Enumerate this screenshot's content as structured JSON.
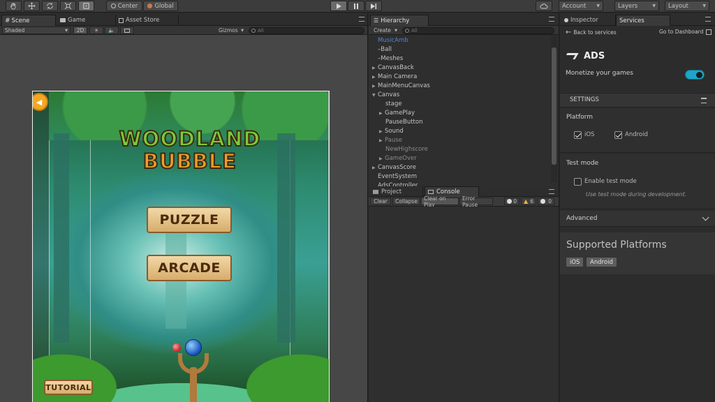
{
  "toolbar": {
    "pivot": "Center",
    "space": "Global",
    "account": "Account",
    "layers": "Layers",
    "layout": "Layout"
  },
  "scene": {
    "tabs": [
      "Scene",
      "Game",
      "Asset Store"
    ],
    "shading": "Shaded",
    "mode2d": "2D",
    "gizmos": "Gizmos",
    "search_placeholder": "All"
  },
  "game": {
    "title_line1": "WOODLAND",
    "title_line2": "BUBBLE",
    "puzzle": "PUZZLE",
    "arcade": "ARCADE",
    "tutorial": "TUTORIAL"
  },
  "hierarchy": {
    "tab": "Hierarchy",
    "create": "Create",
    "search_placeholder": "All",
    "items": [
      "MusicAmb",
      "Ball",
      "Meshes",
      "CanvasBack",
      "Main Camera",
      "MainMenuCanvas",
      "Canvas",
      "stage",
      "GamePlay",
      "PauseButton",
      "Sound",
      "Pause",
      "NewHighscore",
      "GameOver",
      "CanvasScore",
      "EventSystem",
      "AdsController"
    ]
  },
  "console": {
    "tabs": [
      "Project",
      "Console"
    ],
    "buttons": [
      "Clear",
      "Collapse",
      "Clear on Play",
      "Error Pause"
    ],
    "counts": [
      "0",
      "6",
      "0"
    ]
  },
  "inspector": {
    "tabs": [
      "Inspector",
      "Services"
    ],
    "back": "Back to services",
    "dashboard": "Go to Dashboard",
    "service_name": "ADS",
    "monetize": "Monetize your games",
    "settings": "SETTINGS",
    "platform": "Platform",
    "ios": "iOS",
    "android": "Android",
    "test_mode": "Test mode",
    "enable_test": "Enable test mode",
    "test_hint": "Use test mode during development.",
    "advanced": "Advanced",
    "supported": "Supported Platforms",
    "platform_tags": [
      "iOS",
      "Android"
    ]
  },
  "colors": {
    "accent": "#3d8bd8",
    "toggle": "#1ea5c7"
  }
}
